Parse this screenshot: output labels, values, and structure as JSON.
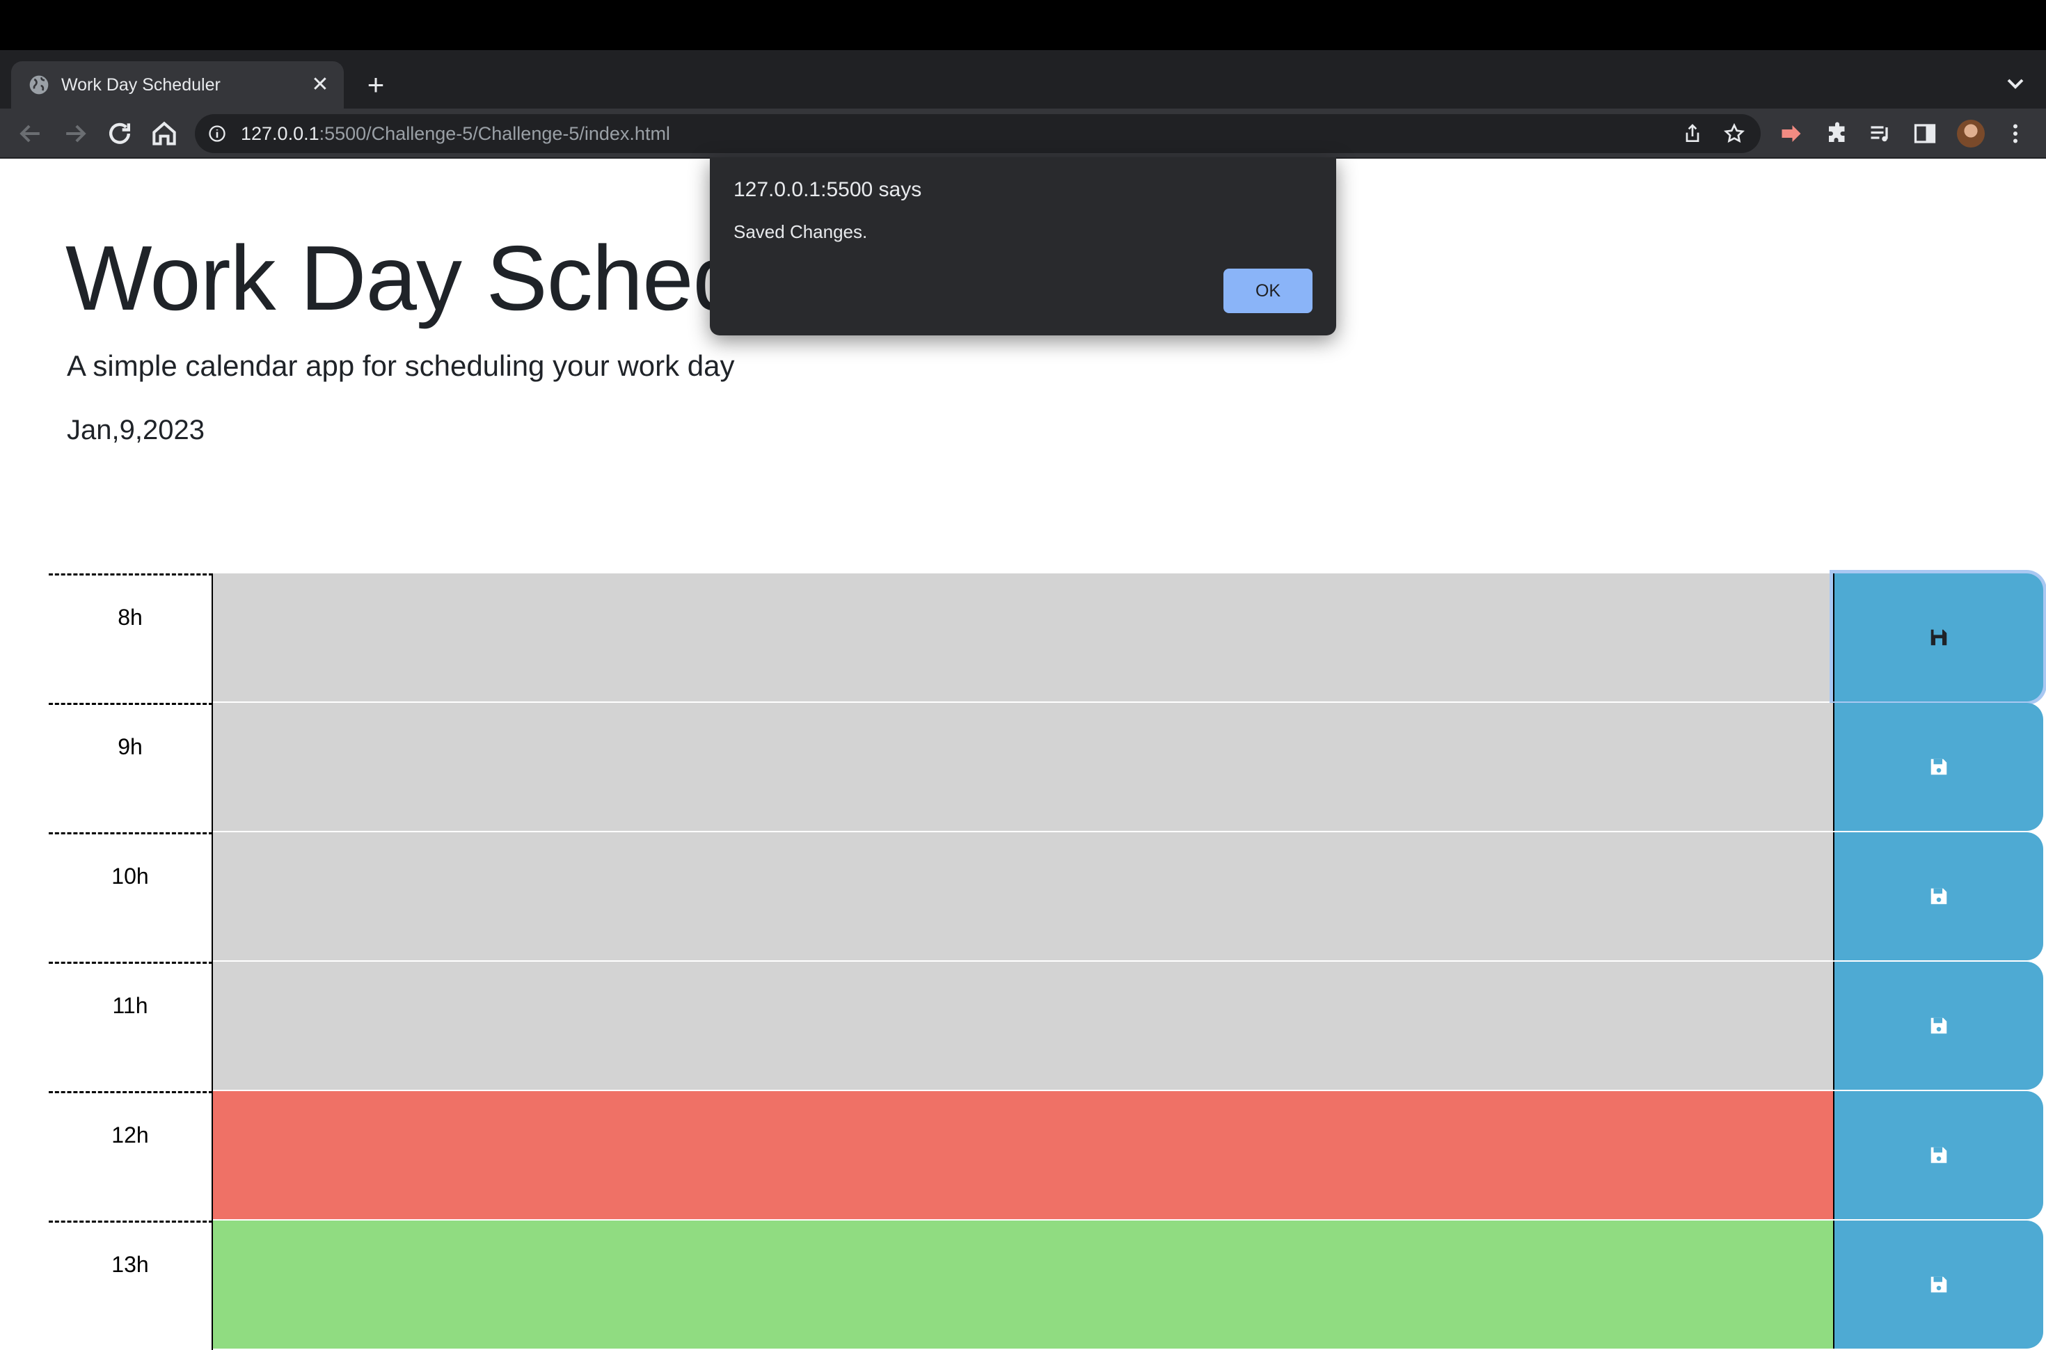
{
  "browser": {
    "tab": {
      "title": "Work Day Scheduler",
      "close_glyph": "✕",
      "icon": "globe-icon"
    },
    "new_tab_glyph": "+",
    "url": {
      "host": "127.0.0.1",
      "rest": ":5500/Challenge-5/Challenge-5/index.html"
    }
  },
  "alert": {
    "title": "127.0.0.1:5500 says",
    "message": "Saved Changes.",
    "ok_label": "OK"
  },
  "header": {
    "title": "Work Day Scheduler",
    "subtitle": "A simple calendar app for scheduling your work day",
    "date": "Jan,9,2023"
  },
  "colors": {
    "past": "#d3d3d3",
    "present": "#ef7166",
    "future": "#90dc81",
    "save_button": "#4eaad3",
    "alert_ok": "#8ab4f8"
  },
  "timeblocks": [
    {
      "hour": "8h",
      "state": "past",
      "text": ""
    },
    {
      "hour": "9h",
      "state": "past",
      "text": ""
    },
    {
      "hour": "10h",
      "state": "past",
      "text": ""
    },
    {
      "hour": "11h",
      "state": "past",
      "text": ""
    },
    {
      "hour": "12h",
      "state": "present",
      "text": ""
    },
    {
      "hour": "13h",
      "state": "future",
      "text": ""
    }
  ]
}
